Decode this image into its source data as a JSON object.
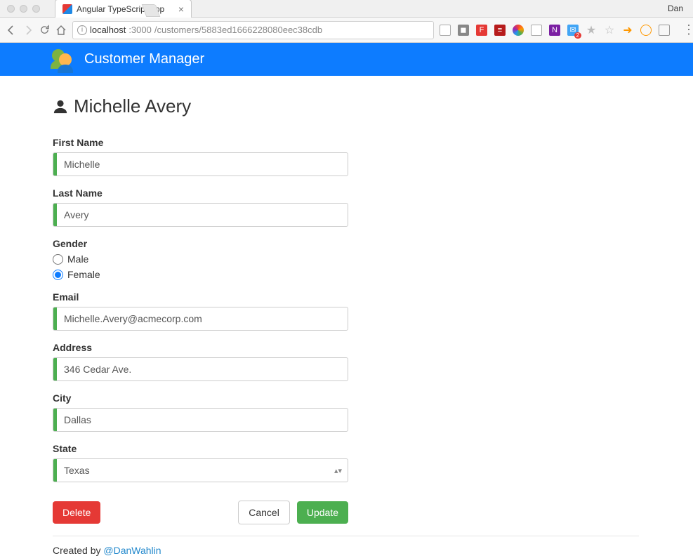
{
  "browser": {
    "profile_name": "Dan",
    "tab_title": "Angular TypeScript App",
    "url_host": "localhost",
    "url_port": ":3000",
    "url_path": "/customers/5883ed1666228080eec38cdb"
  },
  "banner": {
    "title": "Customer Manager"
  },
  "heading": {
    "name": "Michelle Avery"
  },
  "form": {
    "first_name_label": "First Name",
    "first_name_value": "Michelle",
    "last_name_label": "Last Name",
    "last_name_value": "Avery",
    "gender_label": "Gender",
    "gender_options": {
      "male": "Male",
      "female": "Female"
    },
    "gender_selected": "female",
    "email_label": "Email",
    "email_value": "Michelle.Avery@acmecorp.com",
    "address_label": "Address",
    "address_value": "346 Cedar Ave.",
    "city_label": "City",
    "city_value": "Dallas",
    "state_label": "State",
    "state_value": "Texas"
  },
  "buttons": {
    "delete": "Delete",
    "cancel": "Cancel",
    "update": "Update"
  },
  "footer": {
    "prefix": "Created by ",
    "handle": "@DanWahlin"
  }
}
